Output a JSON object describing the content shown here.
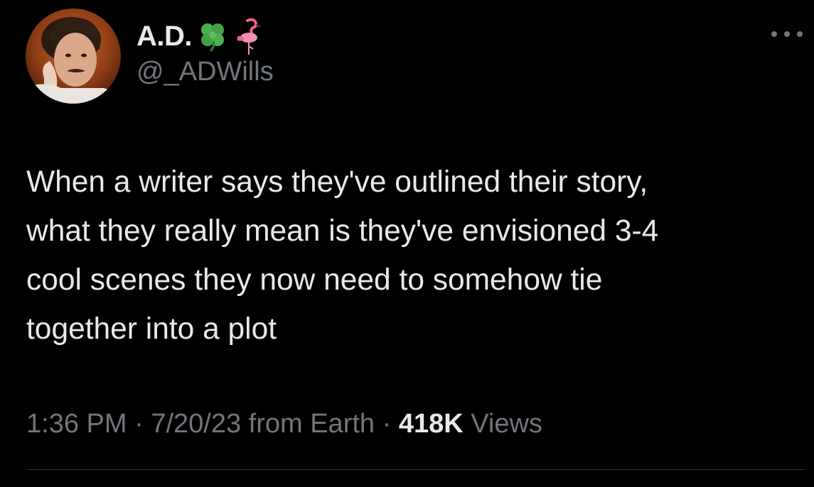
{
  "author": {
    "display_name": "A.D.",
    "handle": "@_ADWills",
    "emojis": [
      "four-leaf-clover",
      "flamingo"
    ]
  },
  "tweet": {
    "text": "When a writer says they've outlined their story,\nwhat they really mean is they've envisioned 3-4\ncool scenes they now need to somehow tie\ntogether into a plot"
  },
  "meta": {
    "time": "1:36 PM",
    "separator": " · ",
    "date_source": "7/20/23 from Earth",
    "views_count": "418K",
    "views_label": " Views"
  },
  "colors": {
    "background": "#000000",
    "primary_text": "#e7e9ea",
    "secondary_text": "#71767b",
    "divider": "#2f3336"
  }
}
